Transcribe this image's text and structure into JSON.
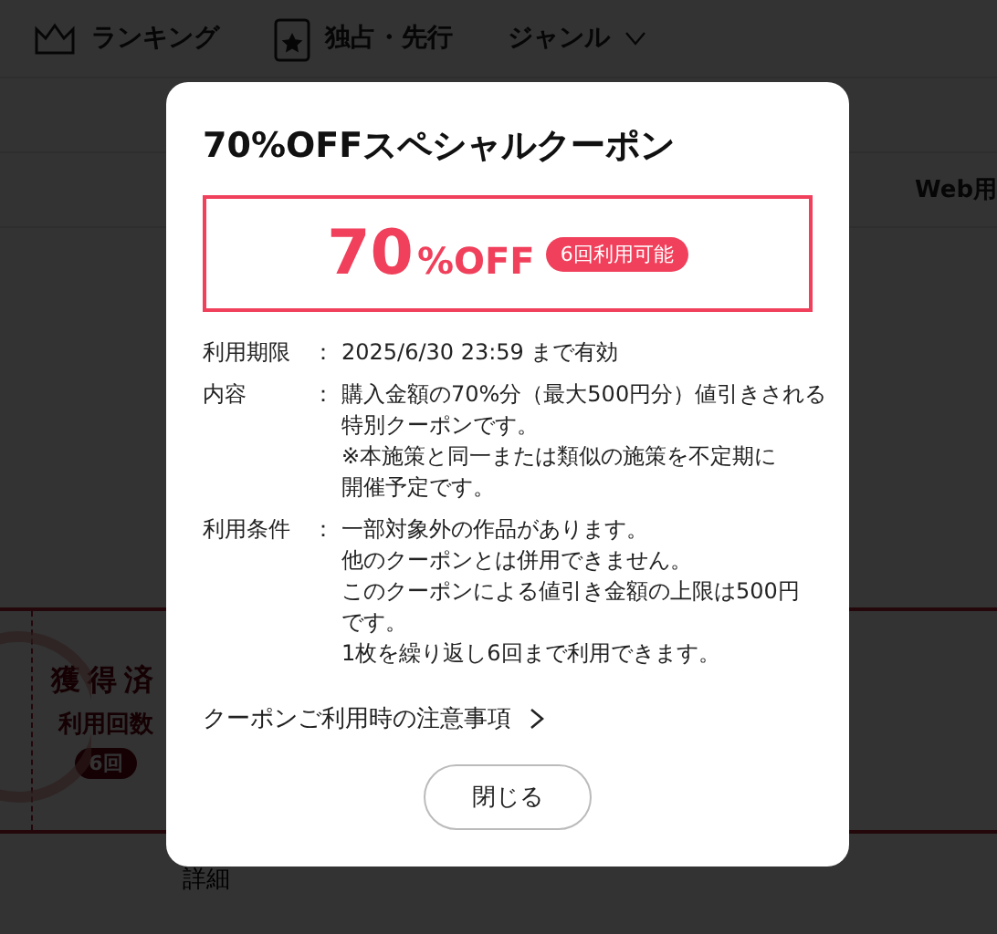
{
  "nav": [
    {
      "label": "ランキング",
      "kind": "crown"
    },
    {
      "label": "独占・先行",
      "kind": "book"
    },
    {
      "label": "ジャンル",
      "kind": "dropdown"
    }
  ],
  "table_header": {
    "column_3": "Web用"
  },
  "coupon_card": {
    "status": "獲得済",
    "uses_label": "利用回数",
    "uses": "6回",
    "details_link": "詳細"
  },
  "modal": {
    "title": "70%OFFスペシャルクーポン",
    "discount": {
      "amount": "70",
      "unit": "%OFF",
      "badge": "6回利用可能"
    },
    "terms": [
      {
        "label": "利用期限",
        "separator": "：",
        "lines": [
          "2025/6/30 23:59 まで有効"
        ]
      },
      {
        "label": "内容",
        "separator": "：",
        "lines": [
          "購入金額の70%分（最大500円分）値引きされる",
          "特別クーポンです。",
          "※本施策と同一または類似の施策を不定期に",
          "開催予定です。"
        ]
      },
      {
        "label": "利用条件",
        "separator": "：",
        "lines": [
          "一部対象外の作品があります。",
          "他のクーポンとは併用できません。",
          "このクーポンによる値引き金額の上限は500円",
          "です。",
          "1枚を繰り返し6回まで利用できます。"
        ]
      }
    ],
    "notes_link": "クーポンご利用時の注意事項",
    "close_button": "閉じる"
  }
}
